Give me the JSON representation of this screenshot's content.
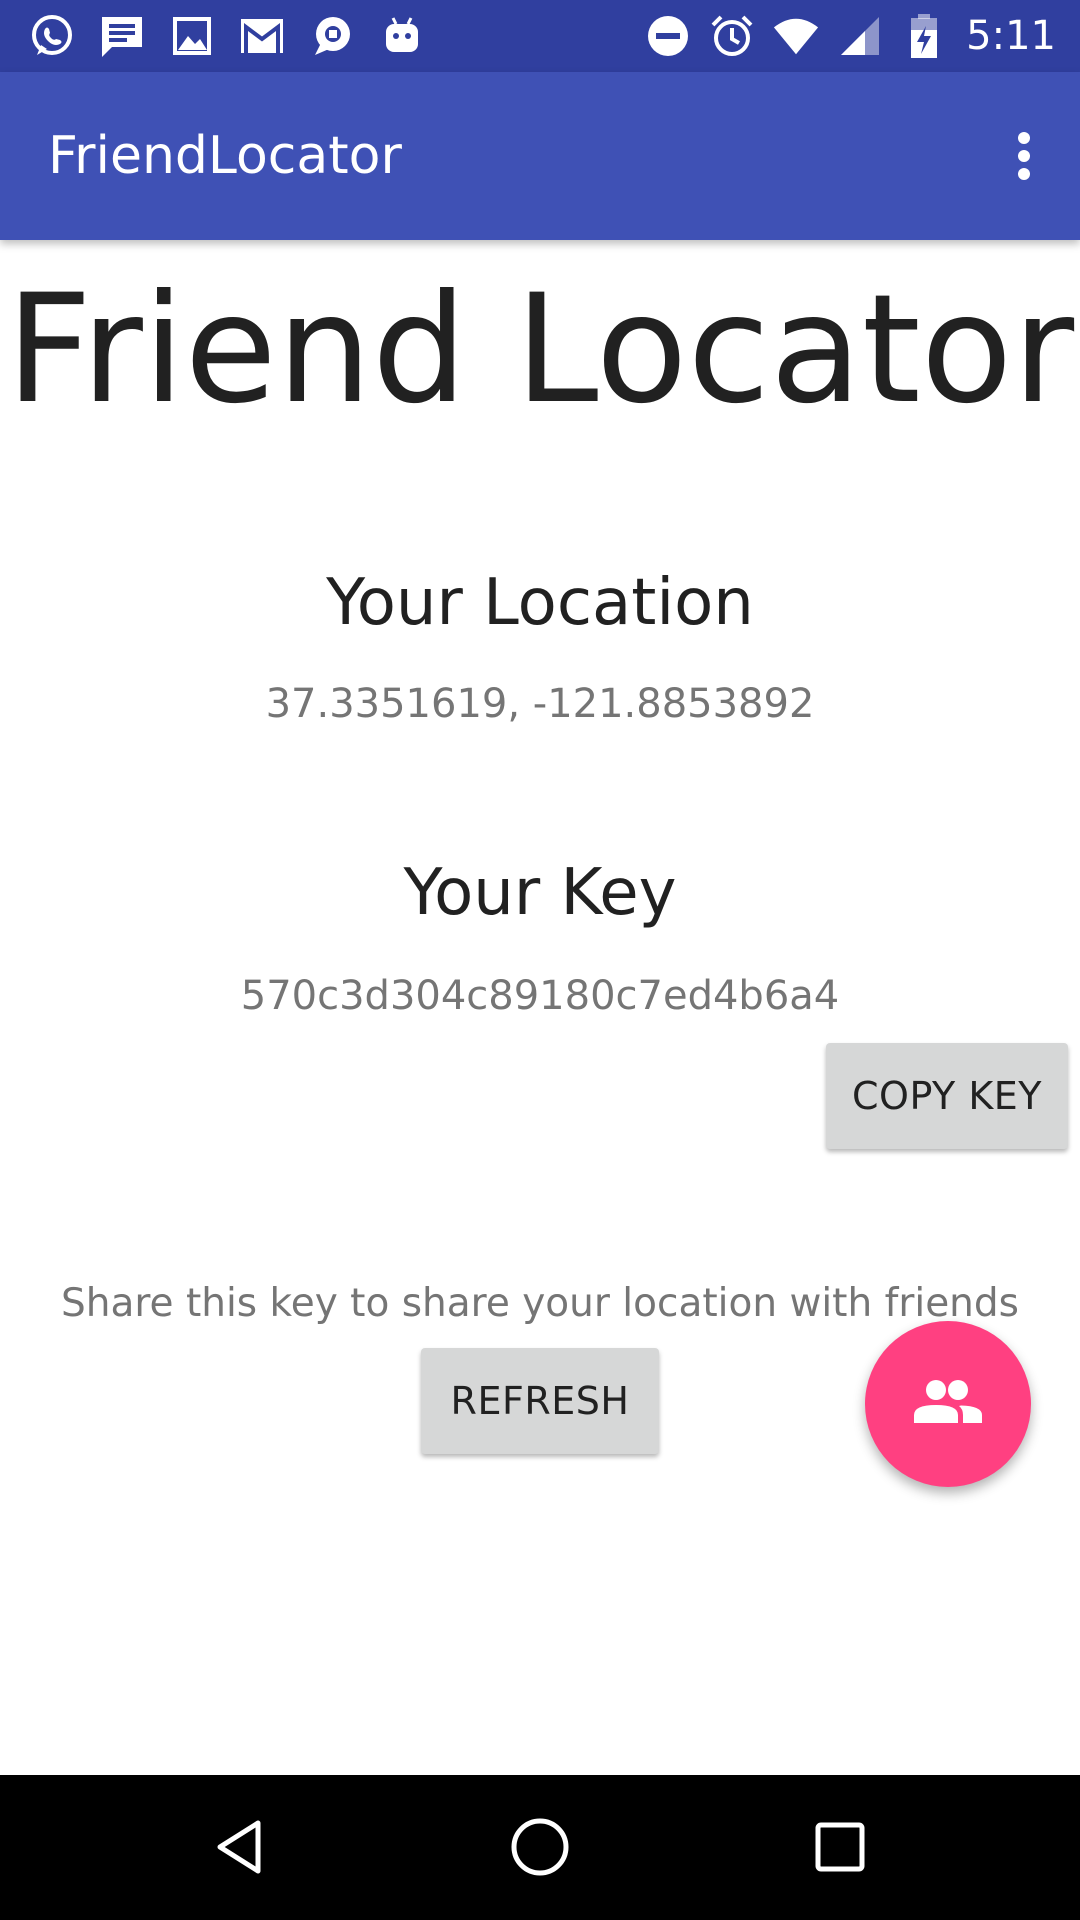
{
  "status_bar": {
    "time": "5:11",
    "left_icons": [
      "whatsapp-icon",
      "message-icon",
      "image-icon",
      "gmail-icon",
      "chat-icon",
      "android-icon"
    ],
    "right_icons": [
      "do-not-disturb-icon",
      "alarm-icon",
      "wifi-icon",
      "signal-icon",
      "battery-charging-icon"
    ]
  },
  "app_bar": {
    "title": "FriendLocator",
    "menu_icon": "more-vert-icon"
  },
  "main": {
    "heading": "Friend Locator",
    "location": {
      "label": "Your Location",
      "value": "37.3351619, -121.8853892"
    },
    "key": {
      "label": "Your Key",
      "value": "570c3d304c89180c7ed4b6a4",
      "copy_button": "COPY KEY"
    },
    "share_text": "Share this key to share your location with friends",
    "refresh_button": "REFRESH"
  },
  "fab": {
    "icon": "people-icon",
    "color": "#ff4081"
  },
  "nav_bar": {
    "buttons": [
      "back-icon",
      "home-icon",
      "recents-icon"
    ]
  },
  "colors": {
    "primary": "#3f51b5",
    "primary_dark": "#303f9f",
    "accent": "#ff4081"
  }
}
